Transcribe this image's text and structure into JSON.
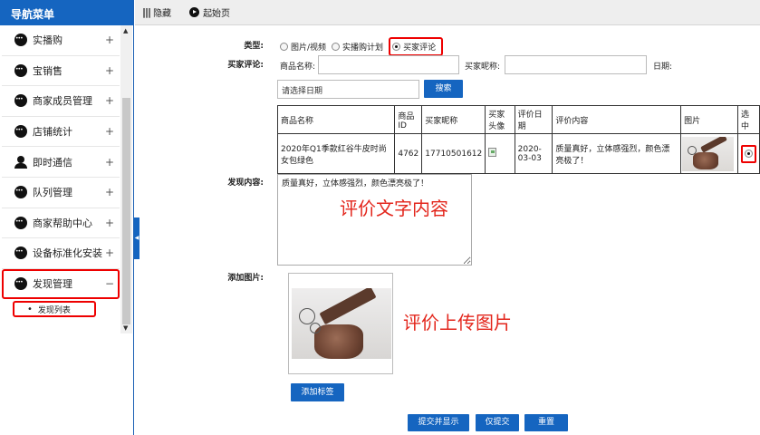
{
  "sidebar": {
    "title": "导航菜单",
    "items": [
      {
        "label": "实播购",
        "expander": "+",
        "icon": "dots-icon"
      },
      {
        "label": "宝销售",
        "expander": "+",
        "icon": "dots-icon"
      },
      {
        "label": "商家成员管理",
        "expander": "+",
        "icon": "dots-icon"
      },
      {
        "label": "店铺统计",
        "expander": "+",
        "icon": "dots-icon"
      },
      {
        "label": "即时通信",
        "expander": "+",
        "icon": "person-icon"
      },
      {
        "label": "队列管理",
        "expander": "+",
        "icon": "dots-icon"
      },
      {
        "label": "商家帮助中心",
        "expander": "+",
        "icon": "dots-icon"
      },
      {
        "label": "设备标准化安装",
        "expander": "+",
        "icon": "dots-icon"
      },
      {
        "label": "发现管理",
        "expander": "−",
        "icon": "dots-icon"
      }
    ],
    "sub_item": "发现列表"
  },
  "topbar": {
    "hide_label": "隐藏",
    "start_label": "起始页"
  },
  "form": {
    "type_label": "类型:",
    "type_options": [
      "图片/视频",
      "实播购计划",
      "买家评论"
    ],
    "type_selected": "买家评论",
    "buyer_comment_label": "买家评论:",
    "product_name_label": "商品名称:",
    "product_name_value": "",
    "buyer_nick_label": "买家昵称:",
    "buyer_nick_value": "",
    "date_label": "日期:",
    "date_placeholder": "请选择日期",
    "search_button": "搜索",
    "discover_content_label": "发现内容:",
    "discover_content_value": "质量真好，立体感强烈，颜色漂亮极了！",
    "add_image_label": "添加图片:",
    "add_tag_button": "添加标签",
    "submit_show_button": "提交并显示",
    "submit_only_button": "仅提交",
    "reset_button": "重置"
  },
  "table": {
    "headers": [
      "商品名称",
      "商品ID",
      "买家昵称",
      "买家头像",
      "评价日期",
      "评价内容",
      "图片",
      "选中"
    ],
    "rows": [
      {
        "product_name": "2020年Q1季款红谷牛皮时尚女包绿色",
        "product_id": "4762",
        "buyer_nick": "17710501612",
        "review_date": "2020-03-03",
        "review_content": "质量真好，立体感强烈，颜色漂亮极了！",
        "selected": true
      }
    ]
  },
  "annotations": {
    "text_content": "评价文字内容",
    "upload_image": "评价上传图片",
    "color": "#e3261c"
  },
  "colors": {
    "brand_blue": "#1565c0",
    "highlight_red": "#ee0000"
  }
}
